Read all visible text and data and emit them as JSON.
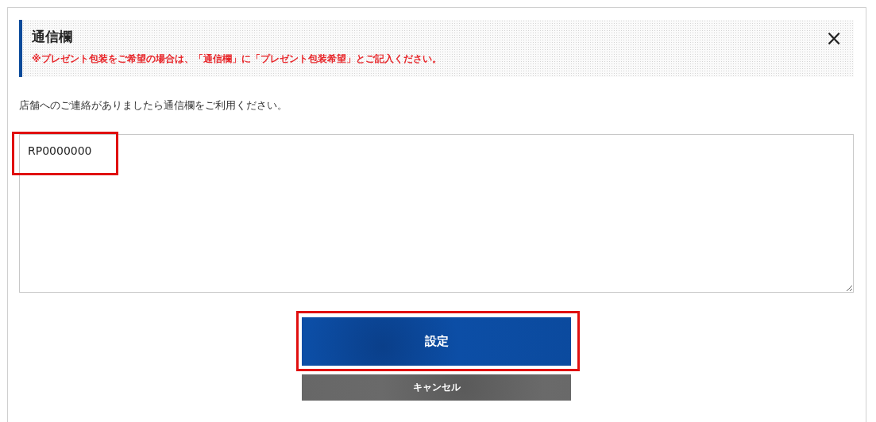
{
  "header": {
    "title": "通信欄",
    "notice": "※プレゼント包装をご希望の場合は、「通信欄」に「プレゼント包装希望」とご記入ください。",
    "close": "×"
  },
  "description": "店舗へのご連絡がありましたら通信欄をご利用ください。",
  "message_field": {
    "value": "RP0000000",
    "highlighted": true
  },
  "buttons": [
    {
      "label": "設定",
      "kind": "primary",
      "highlighted": true
    },
    {
      "label": "キャンセル",
      "kind": "secondary",
      "highlighted": false
    }
  ]
}
